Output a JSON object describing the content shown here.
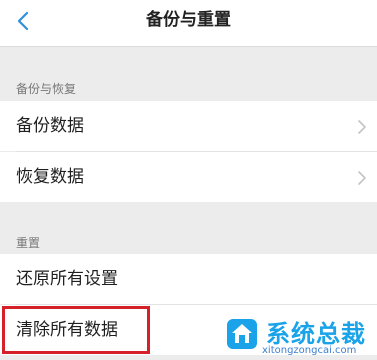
{
  "header": {
    "title": "备份与重置",
    "back_icon": "chevron-left-icon"
  },
  "sections": [
    {
      "header": "备份与恢复",
      "items": [
        {
          "label": "备份数据",
          "chevron": "chevron-right-icon"
        },
        {
          "label": "恢复数据",
          "chevron": "chevron-right-icon"
        }
      ]
    },
    {
      "header": "重置",
      "items": [
        {
          "label": "还原所有设置"
        },
        {
          "label": "清除所有数据",
          "highlighted": true
        }
      ]
    }
  ],
  "watermark": {
    "brand": "系统总裁",
    "url": "xitongzongcai.com"
  },
  "colors": {
    "accent": "#2f8fd8",
    "highlight_border": "#d5212a",
    "background": "#ececec"
  }
}
